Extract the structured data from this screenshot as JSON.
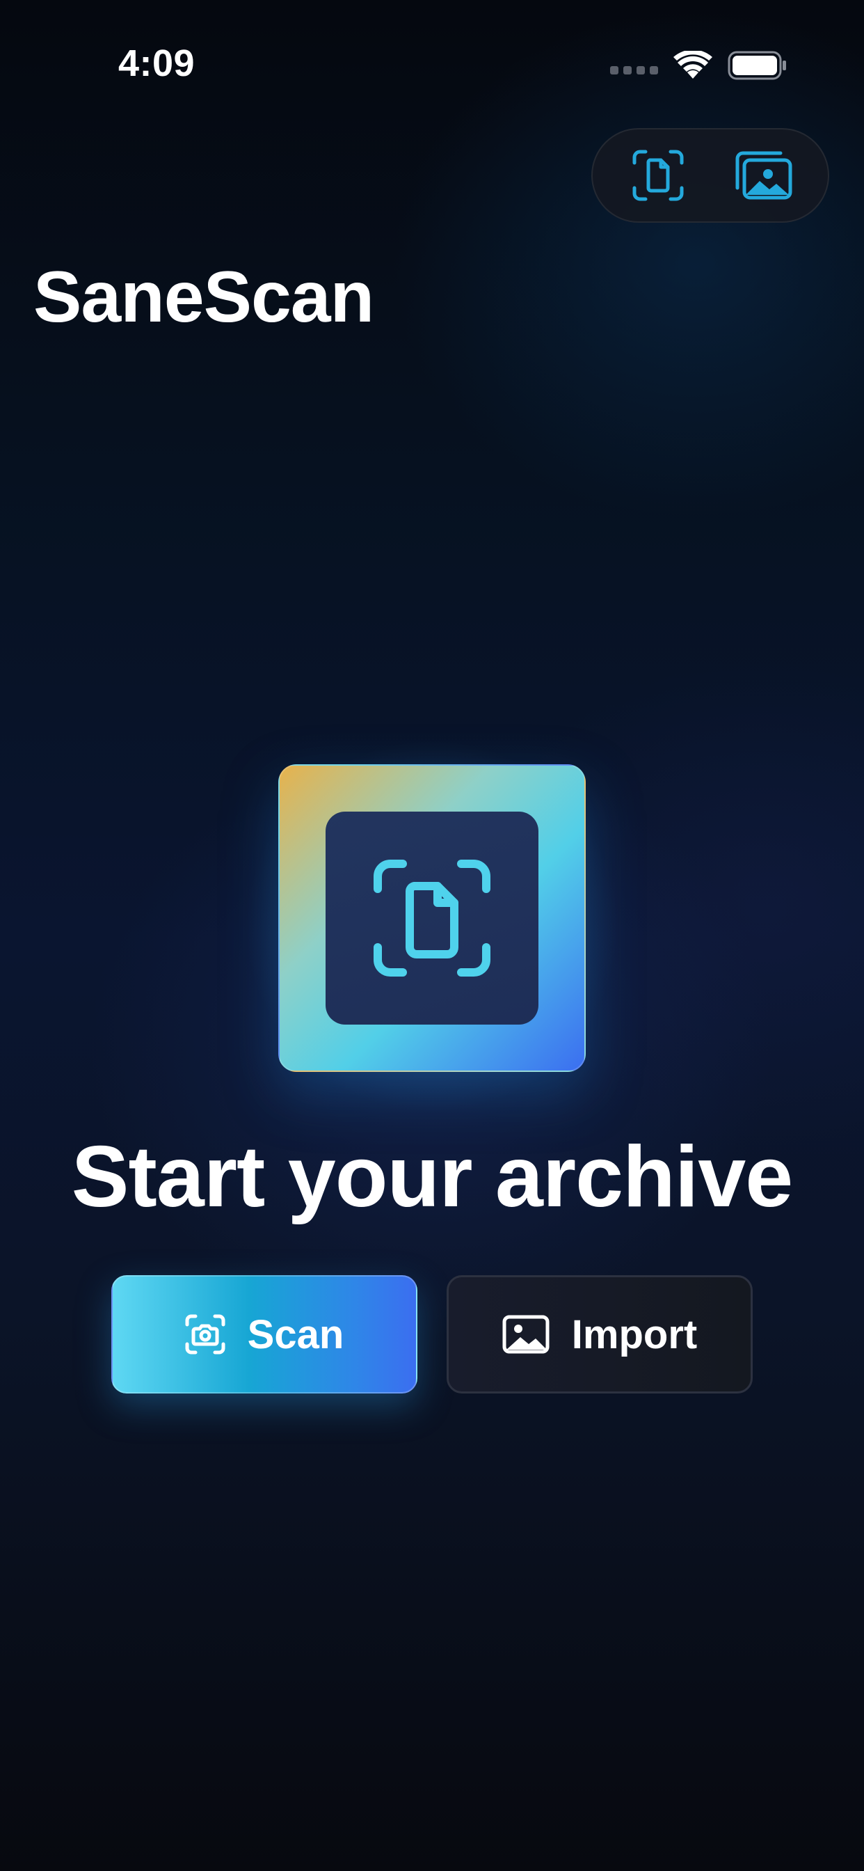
{
  "status_bar": {
    "time": "4:09"
  },
  "toolbar": {
    "scan_icon": "doc-viewfinder-icon",
    "gallery_icon": "photo-stack-icon",
    "icon_color": "#24a9dc"
  },
  "app": {
    "title": "SaneScan"
  },
  "hero": {
    "icon": "doc-viewfinder-icon",
    "icon_color": "#4fd2ec"
  },
  "empty_state": {
    "headline": "Start your archive"
  },
  "actions": {
    "scan_label": "Scan",
    "scan_icon": "camera-viewfinder-icon",
    "import_label": "Import",
    "import_icon": "photo-icon"
  },
  "colors": {
    "accent": "#17a6d4",
    "accent_end": "#3b6ef0",
    "background": "#0a1530"
  }
}
